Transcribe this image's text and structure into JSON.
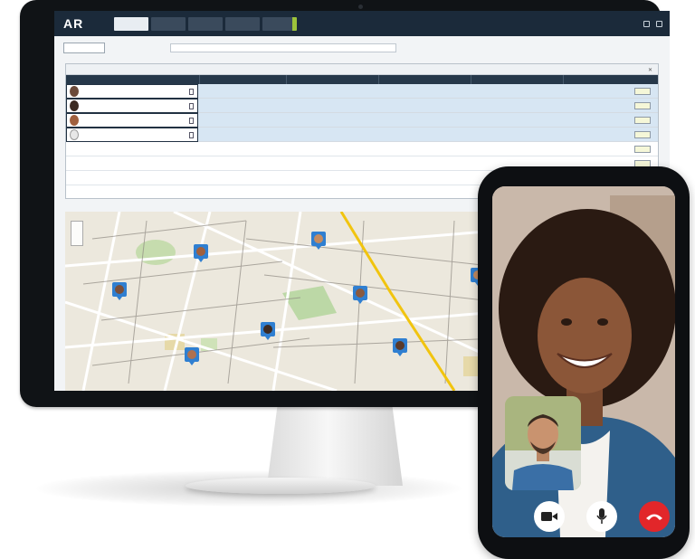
{
  "app": {
    "logo": "AR",
    "tabs": [
      "",
      "",
      "",
      "",
      ""
    ]
  },
  "call": {
    "video_icon": "video-camera-icon",
    "mic_icon": "microphone-icon",
    "end_icon": "phone-hangup-icon",
    "end_color": "#e2262a"
  }
}
